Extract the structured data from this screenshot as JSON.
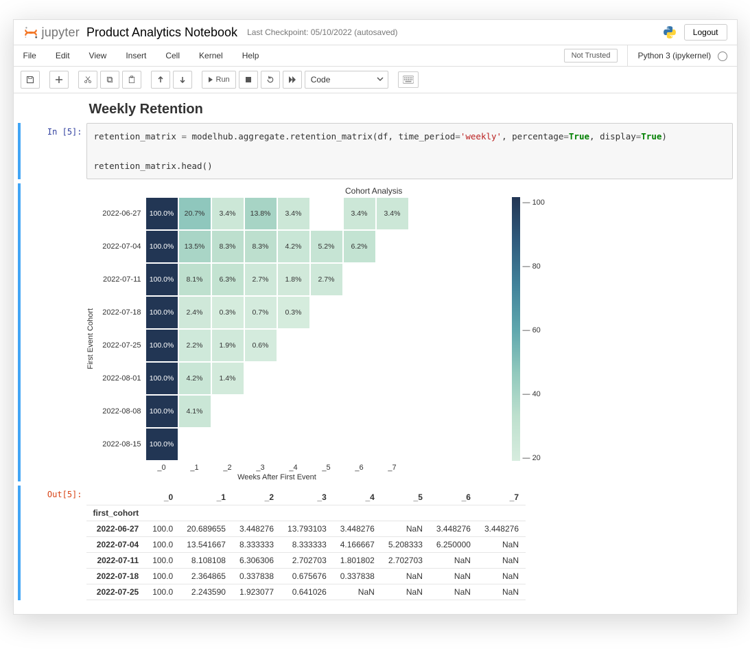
{
  "header": {
    "brand": "jupyter",
    "title": "Product Analytics Notebook",
    "checkpoint": "Last Checkpoint: 05/10/2022  (autosaved)",
    "logout": "Logout"
  },
  "menubar": {
    "items": [
      "File",
      "Edit",
      "View",
      "Insert",
      "Cell",
      "Kernel",
      "Help"
    ],
    "trusted": "Not Trusted",
    "kernel": "Python 3 (ipykernel)"
  },
  "toolbar": {
    "run_label": "Run",
    "celltype": "Code"
  },
  "markdown": {
    "title": "Weekly Retention"
  },
  "code": {
    "in_prompt": "In [5]:",
    "out_prompt": "Out[5]:",
    "line1_a": "retention_matrix ",
    "line1_b": "=",
    "line1_c": " modelhub.aggregate.retention_matrix(df, time_period",
    "line1_d": "=",
    "line1_e": "'weekly'",
    "line1_f": ", percentage",
    "line1_g": "=",
    "line1_h": "True",
    "line1_i": ", display",
    "line1_j": "=",
    "line1_k": "True",
    "line1_l": ")",
    "line2": "retention_matrix.head()"
  },
  "chart_data": {
    "type": "heatmap",
    "title": "Cohort Analysis",
    "xlabel": "Weeks After First Event",
    "ylabel": "First Event Cohort",
    "x": [
      "_0",
      "_1",
      "_2",
      "_3",
      "_4",
      "_5",
      "_6",
      "_7"
    ],
    "y": [
      "2022-06-27",
      "2022-07-04",
      "2022-07-11",
      "2022-07-18",
      "2022-07-25",
      "2022-08-01",
      "2022-08-08",
      "2022-08-15"
    ],
    "values": [
      [
        100.0,
        20.7,
        3.4,
        13.8,
        3.4,
        null,
        3.4,
        3.4
      ],
      [
        100.0,
        13.5,
        8.3,
        8.3,
        4.2,
        5.2,
        6.2,
        null
      ],
      [
        100.0,
        8.1,
        6.3,
        2.7,
        1.8,
        2.7,
        null,
        null
      ],
      [
        100.0,
        2.4,
        0.3,
        0.7,
        0.3,
        null,
        null,
        null
      ],
      [
        100.0,
        2.2,
        1.9,
        0.6,
        null,
        null,
        null,
        null
      ],
      [
        100.0,
        4.2,
        1.4,
        null,
        null,
        null,
        null,
        null
      ],
      [
        100.0,
        4.1,
        null,
        null,
        null,
        null,
        null,
        null
      ],
      [
        100.0,
        null,
        null,
        null,
        null,
        null,
        null,
        null
      ]
    ],
    "colorbar_ticks": [
      "100",
      "80",
      "60",
      "40",
      "20"
    ],
    "vmin": 0,
    "vmax": 100
  },
  "table": {
    "index_name": "first_cohort",
    "columns": [
      "_0",
      "_1",
      "_2",
      "_3",
      "_4",
      "_5",
      "_6",
      "_7"
    ],
    "rows": [
      {
        "idx": "2022-06-27",
        "vals": [
          "100.0",
          "20.689655",
          "3.448276",
          "13.793103",
          "3.448276",
          "NaN",
          "3.448276",
          "3.448276"
        ]
      },
      {
        "idx": "2022-07-04",
        "vals": [
          "100.0",
          "13.541667",
          "8.333333",
          "8.333333",
          "4.166667",
          "5.208333",
          "6.250000",
          "NaN"
        ]
      },
      {
        "idx": "2022-07-11",
        "vals": [
          "100.0",
          "8.108108",
          "6.306306",
          "2.702703",
          "1.801802",
          "2.702703",
          "NaN",
          "NaN"
        ]
      },
      {
        "idx": "2022-07-18",
        "vals": [
          "100.0",
          "2.364865",
          "0.337838",
          "0.675676",
          "0.337838",
          "NaN",
          "NaN",
          "NaN"
        ]
      },
      {
        "idx": "2022-07-25",
        "vals": [
          "100.0",
          "2.243590",
          "1.923077",
          "0.641026",
          "NaN",
          "NaN",
          "NaN",
          "NaN"
        ]
      }
    ]
  }
}
